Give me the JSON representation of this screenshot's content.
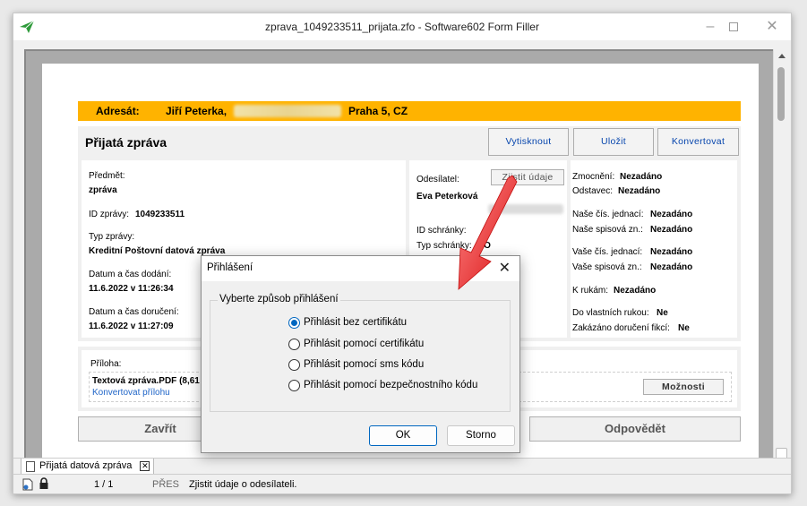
{
  "window": {
    "title": "zprava_1049233511_prijata.zfo - Software602 Form Filler",
    "minimize": "–",
    "close": "✕"
  },
  "address": {
    "label": "Adresát:",
    "name": "Jiří Peterka,",
    "city": "Praha 5, CZ"
  },
  "header": {
    "title": "Přijatá zpráva",
    "print": "Vytisknout",
    "save": "Uložit",
    "convert": "Konvertovat"
  },
  "left": {
    "subject_label": "Předmět:",
    "subject": "zpráva",
    "id_label": "ID zprávy:",
    "id": "1049233511",
    "type_label": "Typ zprávy:",
    "type": "Kreditní Poštovní datová zpráva",
    "delivered_label": "Datum a čas dodání:",
    "delivered": "11.6.2022 v 11:26:34",
    "received_label": "Datum a čas doručení:",
    "received": "11.6.2022 v 11:27:09"
  },
  "middle": {
    "sender_label": "Odesílatel:",
    "sender_btn": "Zjistit údaje",
    "sender": "Eva Peterková",
    "box_id_label": "ID schránky:",
    "box_type_label": "Typ schránky:",
    "box_type": "FO"
  },
  "right": {
    "auth_label": "Zmocnění:",
    "auth": "Nezadáno",
    "para_label": "Odstavec:",
    "para": "Nezadáno",
    "our_ref_label": "Naše čís. jednací:",
    "our_ref": "Nezadáno",
    "our_file_label": "Naše spisová zn.:",
    "our_file": "Nezadáno",
    "your_ref_label": "Vaše čís. jednací:",
    "your_ref": "Nezadáno",
    "your_file_label": "Vaše spisová zn.:",
    "your_file": "Nezadáno",
    "hands_label": "K rukám:",
    "hands": "Nezadáno",
    "own_hands_label": "Do vlastních rukou:",
    "own_hands": "Ne",
    "fiction_label": "Zakázáno doručení fikcí:",
    "fiction": "Ne"
  },
  "attachment": {
    "label": "Příloha:",
    "file": "Textová zpráva.PDF (8,61 k",
    "convert_link": "Konvertovat přílohu",
    "options": "Možnosti"
  },
  "actions": {
    "close": "Zavřít",
    "reply": "Odpovědět"
  },
  "tab": {
    "label": "Přijatá datová zpráva",
    "close": "✕"
  },
  "status": {
    "pages": "1 / 1",
    "mode": "PŘES",
    "message": "Zjistit údaje o odesílateli."
  },
  "dialog": {
    "title": "Přihlášení",
    "group": "Vyberte způsob přihlášení",
    "options": [
      {
        "label": "Přihlásit bez certifikátu",
        "checked": true
      },
      {
        "label": "Přihlásit pomocí certifikátu",
        "checked": false
      },
      {
        "label": "Přihlásit pomocí sms kódu",
        "checked": false
      },
      {
        "label": "Přihlásit pomocí bezpečnostního kódu",
        "checked": false
      }
    ],
    "ok": "OK",
    "cancel": "Storno"
  },
  "colors": {
    "address_bar": "#ffb300",
    "link": "#2166c8",
    "accent": "#0067c0",
    "arrow": "#e3191b"
  },
  "icons": {
    "app": "green-paper-plane-icon",
    "tab": "document-icon",
    "status": [
      "document-icon",
      "lock-icon"
    ]
  }
}
